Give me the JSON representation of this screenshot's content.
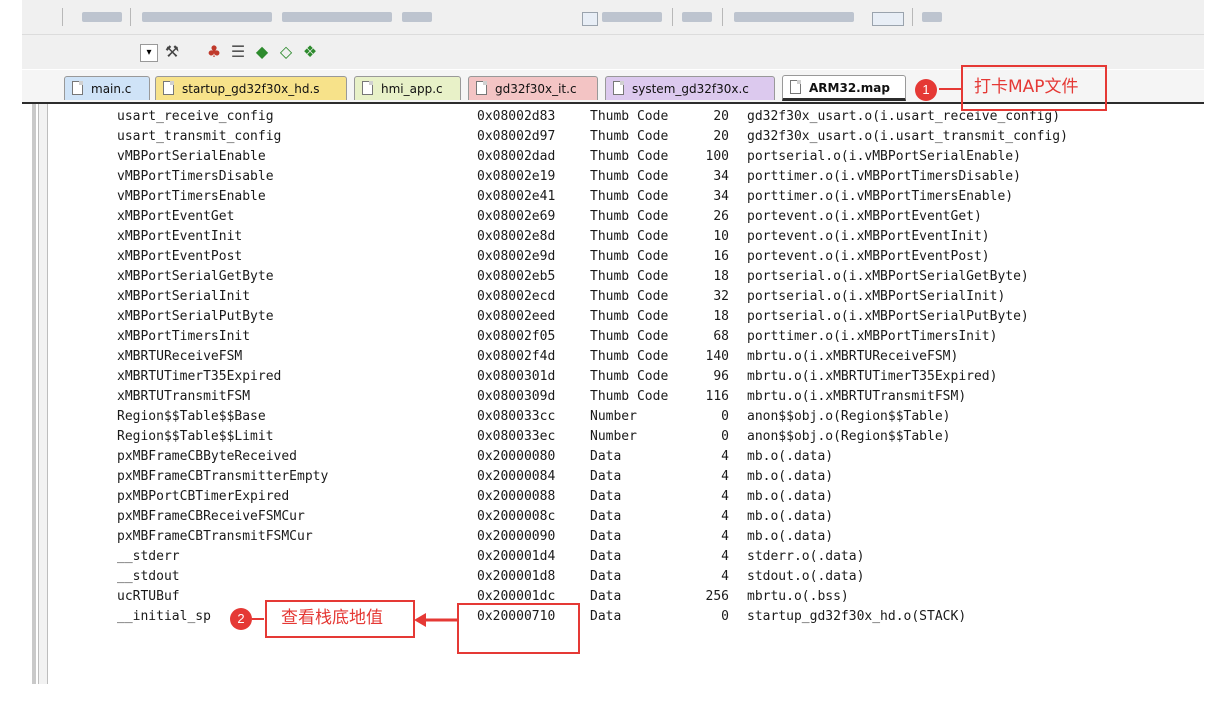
{
  "colors": {
    "annotation": "#e53935",
    "tab_active_underline": "#2c2c2c"
  },
  "toolbar": {
    "row2_icons": [
      "dropdown-icon",
      "wizard-icon",
      "build-icon",
      "stack-icon",
      "diamond-green-icon",
      "diamond-outline-icon",
      "component-icon"
    ]
  },
  "tabs": [
    {
      "label": "main.c",
      "color": "#cfe3f7"
    },
    {
      "label": "startup_gd32f30x_hd.s",
      "color": "#f7e28a"
    },
    {
      "label": "hmi_app.c",
      "color": "#e8f1c8"
    },
    {
      "label": "gd32f30x_it.c",
      "color": "#f3c4c4"
    },
    {
      "label": "system_gd32f30x.c",
      "color": "#dcc9ee"
    },
    {
      "label": "ARM32.map",
      "color": "#ffffff"
    }
  ],
  "symbols": [
    {
      "name": "usart_receive_config",
      "addr": "0x08002d83",
      "type": "Thumb Code",
      "size": "20",
      "obj": "gd32f30x_usart.o(i.usart_receive_config)"
    },
    {
      "name": "usart_transmit_config",
      "addr": "0x08002d97",
      "type": "Thumb Code",
      "size": "20",
      "obj": "gd32f30x_usart.o(i.usart_transmit_config)"
    },
    {
      "name": "vMBPortSerialEnable",
      "addr": "0x08002dad",
      "type": "Thumb Code",
      "size": "100",
      "obj": "portserial.o(i.vMBPortSerialEnable)"
    },
    {
      "name": "vMBPortTimersDisable",
      "addr": "0x08002e19",
      "type": "Thumb Code",
      "size": "34",
      "obj": "porttimer.o(i.vMBPortTimersDisable)"
    },
    {
      "name": "vMBPortTimersEnable",
      "addr": "0x08002e41",
      "type": "Thumb Code",
      "size": "34",
      "obj": "porttimer.o(i.vMBPortTimersEnable)"
    },
    {
      "name": "xMBPortEventGet",
      "addr": "0x08002e69",
      "type": "Thumb Code",
      "size": "26",
      "obj": "portevent.o(i.xMBPortEventGet)"
    },
    {
      "name": "xMBPortEventInit",
      "addr": "0x08002e8d",
      "type": "Thumb Code",
      "size": "10",
      "obj": "portevent.o(i.xMBPortEventInit)"
    },
    {
      "name": "xMBPortEventPost",
      "addr": "0x08002e9d",
      "type": "Thumb Code",
      "size": "16",
      "obj": "portevent.o(i.xMBPortEventPost)"
    },
    {
      "name": "xMBPortSerialGetByte",
      "addr": "0x08002eb5",
      "type": "Thumb Code",
      "size": "18",
      "obj": "portserial.o(i.xMBPortSerialGetByte)"
    },
    {
      "name": "xMBPortSerialInit",
      "addr": "0x08002ecd",
      "type": "Thumb Code",
      "size": "32",
      "obj": "portserial.o(i.xMBPortSerialInit)"
    },
    {
      "name": "xMBPortSerialPutByte",
      "addr": "0x08002eed",
      "type": "Thumb Code",
      "size": "18",
      "obj": "portserial.o(i.xMBPortSerialPutByte)"
    },
    {
      "name": "xMBPortTimersInit",
      "addr": "0x08002f05",
      "type": "Thumb Code",
      "size": "68",
      "obj": "porttimer.o(i.xMBPortTimersInit)"
    },
    {
      "name": "xMBRTUReceiveFSM",
      "addr": "0x08002f4d",
      "type": "Thumb Code",
      "size": "140",
      "obj": "mbrtu.o(i.xMBRTUReceiveFSM)"
    },
    {
      "name": "xMBRTUTimerT35Expired",
      "addr": "0x0800301d",
      "type": "Thumb Code",
      "size": "96",
      "obj": "mbrtu.o(i.xMBRTUTimerT35Expired)"
    },
    {
      "name": "xMBRTUTransmitFSM",
      "addr": "0x0800309d",
      "type": "Thumb Code",
      "size": "116",
      "obj": "mbrtu.o(i.xMBRTUTransmitFSM)"
    },
    {
      "name": "Region$$Table$$Base",
      "addr": "0x080033cc",
      "type": "Number",
      "size": "0",
      "obj": "anon$$obj.o(Region$$Table)"
    },
    {
      "name": "Region$$Table$$Limit",
      "addr": "0x080033ec",
      "type": "Number",
      "size": "0",
      "obj": "anon$$obj.o(Region$$Table)"
    },
    {
      "name": "pxMBFrameCBByteReceived",
      "addr": "0x20000080",
      "type": "Data",
      "size": "4",
      "obj": "mb.o(.data)"
    },
    {
      "name": "pxMBFrameCBTransmitterEmpty",
      "addr": "0x20000084",
      "type": "Data",
      "size": "4",
      "obj": "mb.o(.data)"
    },
    {
      "name": "pxMBPortCBTimerExpired",
      "addr": "0x20000088",
      "type": "Data",
      "size": "4",
      "obj": "mb.o(.data)"
    },
    {
      "name": "pxMBFrameCBReceiveFSMCur",
      "addr": "0x2000008c",
      "type": "Data",
      "size": "4",
      "obj": "mb.o(.data)"
    },
    {
      "name": "pxMBFrameCBTransmitFSMCur",
      "addr": "0x20000090",
      "type": "Data",
      "size": "4",
      "obj": "mb.o(.data)"
    },
    {
      "name": "__stderr",
      "addr": "0x200001d4",
      "type": "Data",
      "size": "4",
      "obj": "stderr.o(.data)"
    },
    {
      "name": "__stdout",
      "addr": "0x200001d8",
      "type": "Data",
      "size": "4",
      "obj": "stdout.o(.data)"
    },
    {
      "name": "ucRTUBuf",
      "addr": "0x200001dc",
      "type": "Data",
      "size": "256",
      "obj": "mbrtu.o(.bss)"
    },
    {
      "name": "__initial_sp",
      "addr": "0x20000710",
      "type": "Data",
      "size": "0",
      "obj": "startup_gd32f30x_hd.o(STACK)"
    }
  ],
  "annotations": {
    "one": {
      "badge": "1",
      "text": "打卡MAP文件"
    },
    "two": {
      "badge": "2",
      "text": "查看栈底地值"
    }
  }
}
